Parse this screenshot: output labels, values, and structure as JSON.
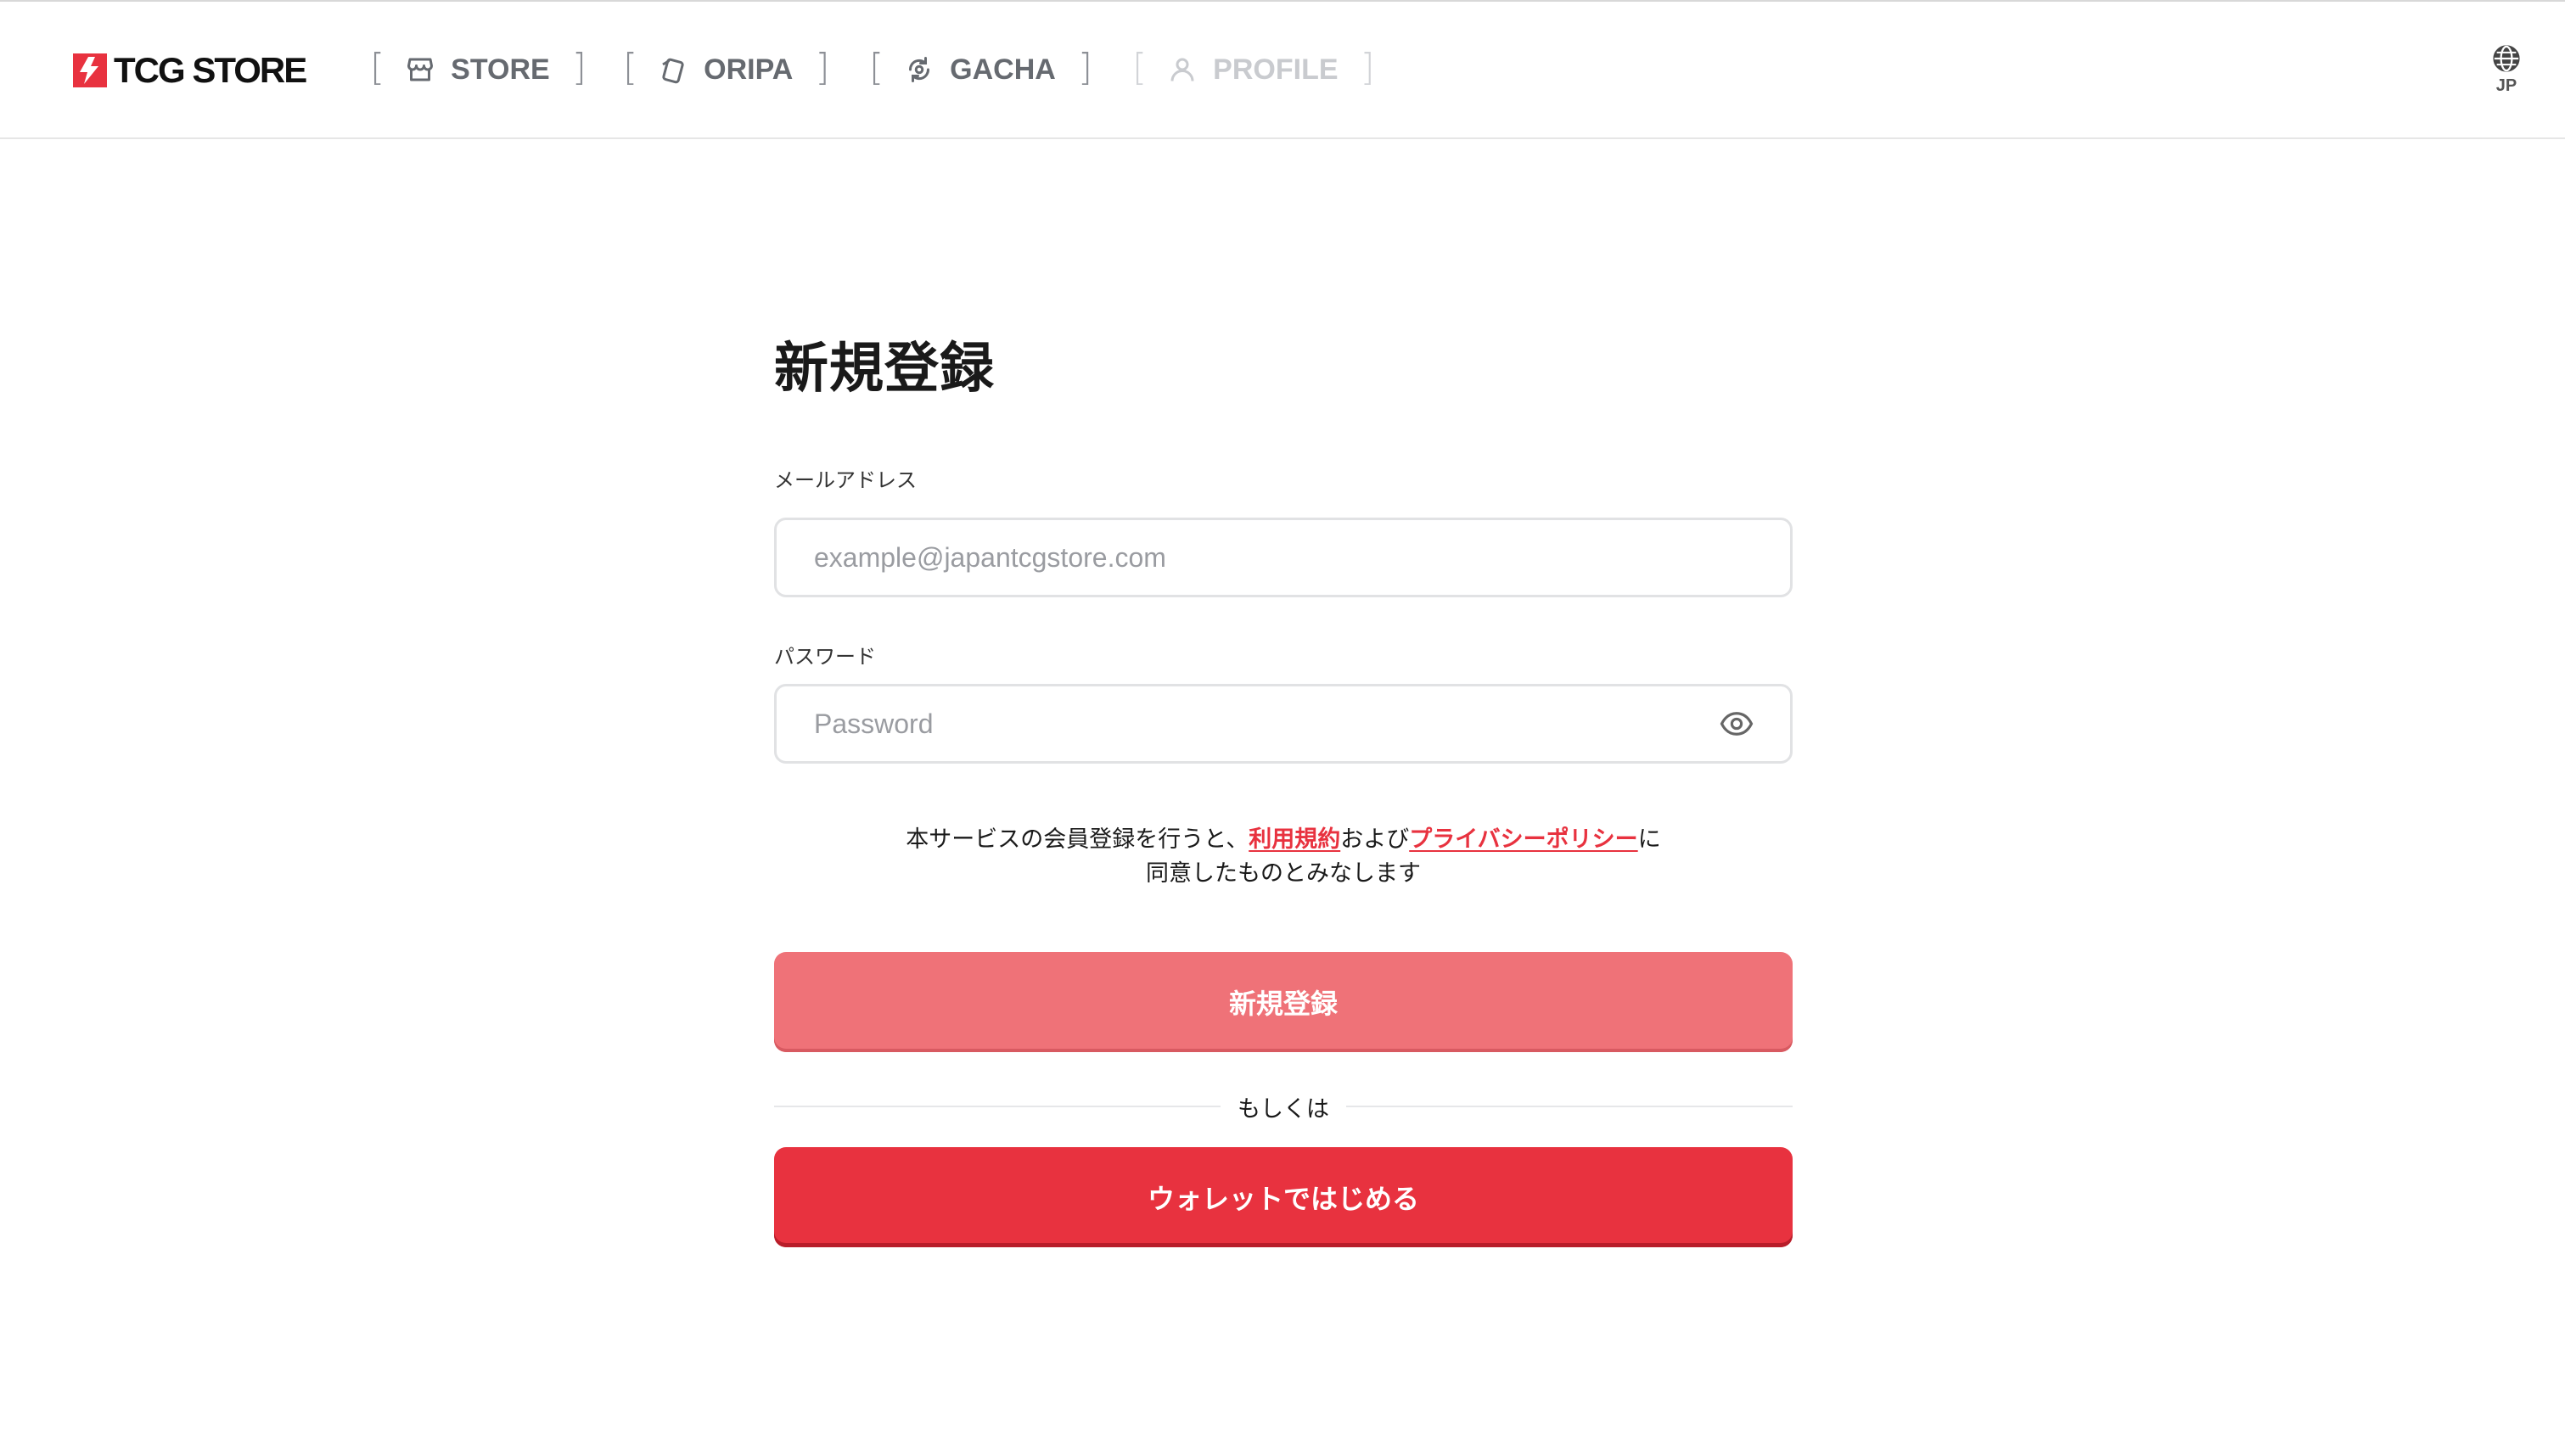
{
  "header": {
    "logo_text": "TCG STORE",
    "nav": [
      {
        "label": "STORE",
        "icon": "store-icon",
        "enabled": true
      },
      {
        "label": "ORIPA",
        "icon": "cards-icon",
        "enabled": true
      },
      {
        "label": "GACHA",
        "icon": "gacha-icon",
        "enabled": true
      },
      {
        "label": "PROFILE",
        "icon": "user-icon",
        "enabled": false
      }
    ],
    "bracket_open": "[",
    "bracket_close": "]",
    "language": {
      "label": "JP",
      "icon": "globe-icon"
    }
  },
  "form": {
    "title": "新規登録",
    "email": {
      "label": "メールアドレス",
      "placeholder": "example@japantcgstore.com",
      "value": ""
    },
    "password": {
      "label": "パスワード",
      "placeholder": "Password",
      "value": "",
      "toggle_icon": "eye-icon"
    },
    "terms": {
      "prefix": "本サービスの会員登録を行うと、",
      "terms_link": "利用規約",
      "middle": "および",
      "privacy_link": "プライバシーポリシー",
      "suffix": "に",
      "line2": "同意したものとみなします"
    },
    "register_button": "新規登録",
    "divider_text": "もしくは",
    "wallet_button": "ウォレットではじめる"
  },
  "colors": {
    "accent": "#e8323f",
    "accent_light": "#ef7278",
    "nav_text": "#666a70",
    "nav_disabled": "#c9cbcf",
    "border": "#e1e2e4"
  }
}
